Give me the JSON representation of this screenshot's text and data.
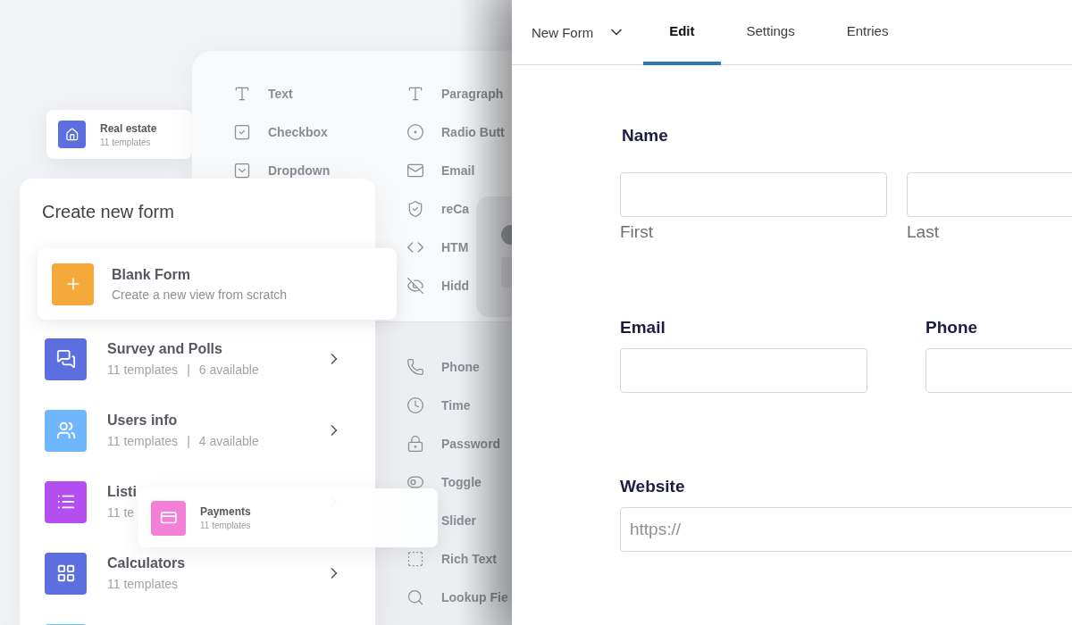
{
  "field_palette": {
    "left": [
      {
        "label": "Text"
      },
      {
        "label": "Checkbox"
      },
      {
        "label": "Dropdown"
      }
    ],
    "right_top": [
      {
        "label": "Paragraph"
      },
      {
        "label": "Radio Butt"
      },
      {
        "label": "Email"
      },
      {
        "label": "reCa"
      },
      {
        "label": "HTM"
      },
      {
        "label": "Hidd"
      }
    ],
    "right_bottom": [
      {
        "label": "Phone"
      },
      {
        "label": "Time"
      },
      {
        "label": "Password"
      },
      {
        "label": "Toggle"
      },
      {
        "label": "Slider"
      },
      {
        "label": "Rich Text"
      },
      {
        "label": "Lookup Fie"
      }
    ]
  },
  "floating_cards": [
    {
      "name": "Real estate",
      "templates": "11 templates",
      "color": "#5b6fe0"
    },
    {
      "name": "Payments",
      "templates": "11 templates",
      "color": "#f47fd6"
    }
  ],
  "create_form": {
    "title": "Create new form",
    "blank": {
      "title": "Blank Form",
      "subtitle": "Create a new view from scratch"
    },
    "categories": [
      {
        "name": "Survey and Polls",
        "templates": "11 templates",
        "separator": "|",
        "available": "6 available",
        "color": "#5b6fe0"
      },
      {
        "name": "Users info",
        "templates": "11 templates",
        "separator": "|",
        "available": "4 available",
        "color": "#6fb6ff"
      },
      {
        "name": "Listi",
        "templates": "11 te",
        "color": "#b44ef0"
      },
      {
        "name": "Calculators",
        "templates": "11 templates",
        "color": "#5b6fe0"
      },
      {
        "color": "#4fd0f0"
      }
    ]
  },
  "editor": {
    "form_name": "New Form",
    "tabs": [
      {
        "label": "Edit",
        "selected": true
      },
      {
        "label": "Settings",
        "selected": false
      },
      {
        "label": "Entries",
        "selected": false
      }
    ],
    "rows": [
      {
        "fields": [
          {
            "label": "Name",
            "parts": [
              {
                "sublabel": "First"
              },
              {
                "sublabel": "Last"
              }
            ]
          }
        ]
      },
      {
        "fields": [
          {
            "label": "Email"
          },
          {
            "label": "Phone"
          }
        ]
      },
      {
        "fields": [
          {
            "label": "Website",
            "placeholder": "https://"
          }
        ]
      }
    ]
  }
}
